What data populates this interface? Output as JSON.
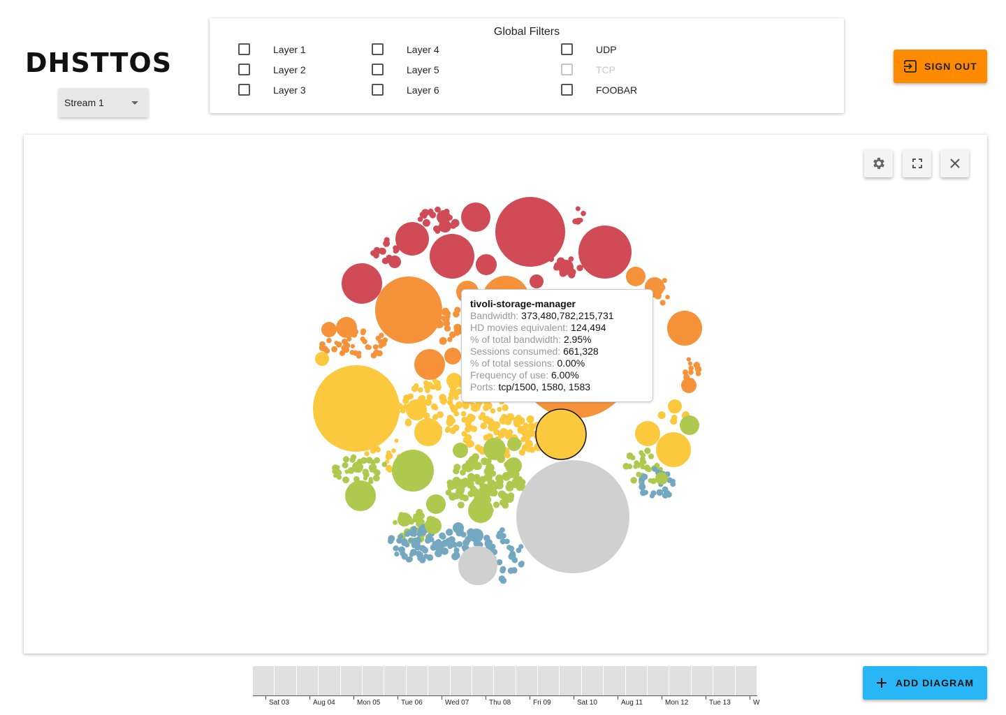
{
  "app": {
    "logo": "DHSTTOS"
  },
  "stream_select": {
    "value": "Stream 1"
  },
  "filters": {
    "title": "Global Filters",
    "items": [
      {
        "label": "Layer 1",
        "checked": false,
        "disabled": false
      },
      {
        "label": "Layer 2",
        "checked": false,
        "disabled": false
      },
      {
        "label": "Layer 3",
        "checked": false,
        "disabled": false
      },
      {
        "label": "Layer 4",
        "checked": false,
        "disabled": false
      },
      {
        "label": "Layer 5",
        "checked": false,
        "disabled": false
      },
      {
        "label": "Layer 6",
        "checked": false,
        "disabled": false
      },
      {
        "label": "UDP",
        "checked": false,
        "disabled": false
      },
      {
        "label": "TCP",
        "checked": false,
        "disabled": true
      },
      {
        "label": "FOOBAR",
        "checked": false,
        "disabled": false
      }
    ]
  },
  "header": {
    "signout_label": "SIGN OUT",
    "signout_color": "#ff8c00"
  },
  "panel": {
    "toolbar": {
      "settings_icon": "gear-icon",
      "fullscreen_icon": "fullscreen-icon",
      "close_icon": "close-icon"
    },
    "tooltip": {
      "title": "tivoli-storage-manager",
      "rows": [
        {
          "key": "Bandwidth:",
          "value": "373,480,782,215,731"
        },
        {
          "key": "HD movies equivalent:",
          "value": "124,494"
        },
        {
          "key": "% of total bandwidth:",
          "value": "2.95%"
        },
        {
          "key": "Sessions consumed:",
          "value": "661,328"
        },
        {
          "key": "% of total sessions:",
          "value": "0.00%"
        },
        {
          "key": "Frequency of use:",
          "value": "6.00%"
        },
        {
          "key": "Ports:",
          "value": "tcp/1500, 1580, 1583"
        }
      ]
    },
    "bubble_colors": {
      "red": "#d04b55",
      "orange": "#f5923a",
      "yellow": "#fcc83e",
      "green": "#aec94e",
      "blue": "#74a7c0",
      "gray": "#d0d0d0"
    }
  },
  "timeline": {
    "labels": [
      "Sat 03",
      "Aug 04",
      "Mon 05",
      "Tue 06",
      "Wed 07",
      "Thu 08",
      "Fri 09",
      "Sat 10",
      "Aug 11",
      "Mon 12",
      "Tue 13",
      "W"
    ],
    "bar_count": 23
  },
  "footer": {
    "add_diagram_label": "ADD DIAGRAM",
    "add_diagram_color": "#29b6f6"
  }
}
